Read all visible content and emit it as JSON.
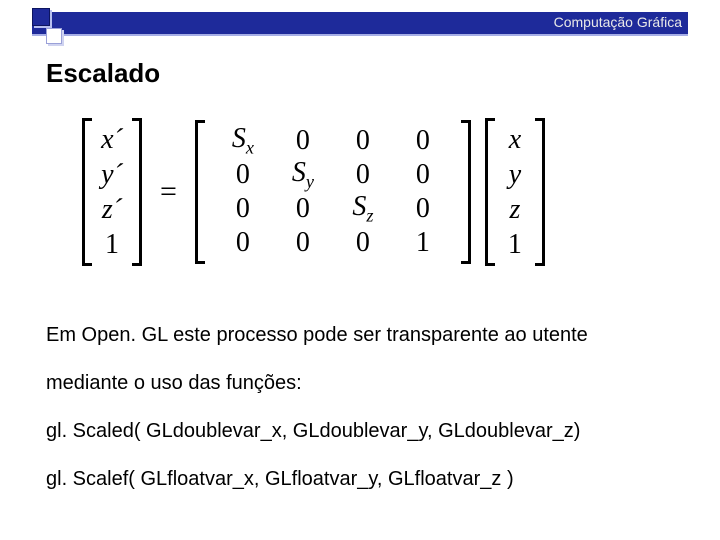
{
  "header": {
    "breadcrumb": "Computação Gráfica",
    "title": "Escalado"
  },
  "equation": {
    "lhs": [
      "x´",
      "y´",
      "z´",
      "1"
    ],
    "matrix": [
      [
        "Sx",
        "0",
        "0",
        "0"
      ],
      [
        "0",
        "Sy",
        "0",
        "0"
      ],
      [
        "0",
        "0",
        "Sz",
        "0"
      ],
      [
        "0",
        "0",
        "0",
        "1"
      ]
    ],
    "rhs": [
      "x",
      "y",
      "z",
      "1"
    ],
    "eq": "="
  },
  "body": {
    "line1": "Em Open. GL este processo pode ser transparente ao utente",
    "line2": "mediante o uso das funções:",
    "line3": "gl. Scaled( GLdoublevar_x, GLdoublevar_y, GLdoublevar_z)",
    "line4": "gl. Scalef( GLfloatvar_x, GLfloatvar_y, GLfloatvar_z )"
  },
  "chart_data": {
    "type": "table",
    "title": "Scaling transformation matrix equation",
    "columns": [
      "c1",
      "c2",
      "c3",
      "c4"
    ],
    "rows": [
      {
        "c1": "Sx",
        "c2": "0",
        "c3": "0",
        "c4": "0"
      },
      {
        "c1": "0",
        "c2": "Sy",
        "c3": "0",
        "c4": "0"
      },
      {
        "c1": "0",
        "c2": "0",
        "c3": "Sz",
        "c4": "0"
      },
      {
        "c1": "0",
        "c2": "0",
        "c3": "0",
        "c4": "1"
      }
    ],
    "lhs_vector": [
      "x'",
      "y'",
      "z'",
      "1"
    ],
    "rhs_vector": [
      "x",
      "y",
      "z",
      "1"
    ]
  }
}
